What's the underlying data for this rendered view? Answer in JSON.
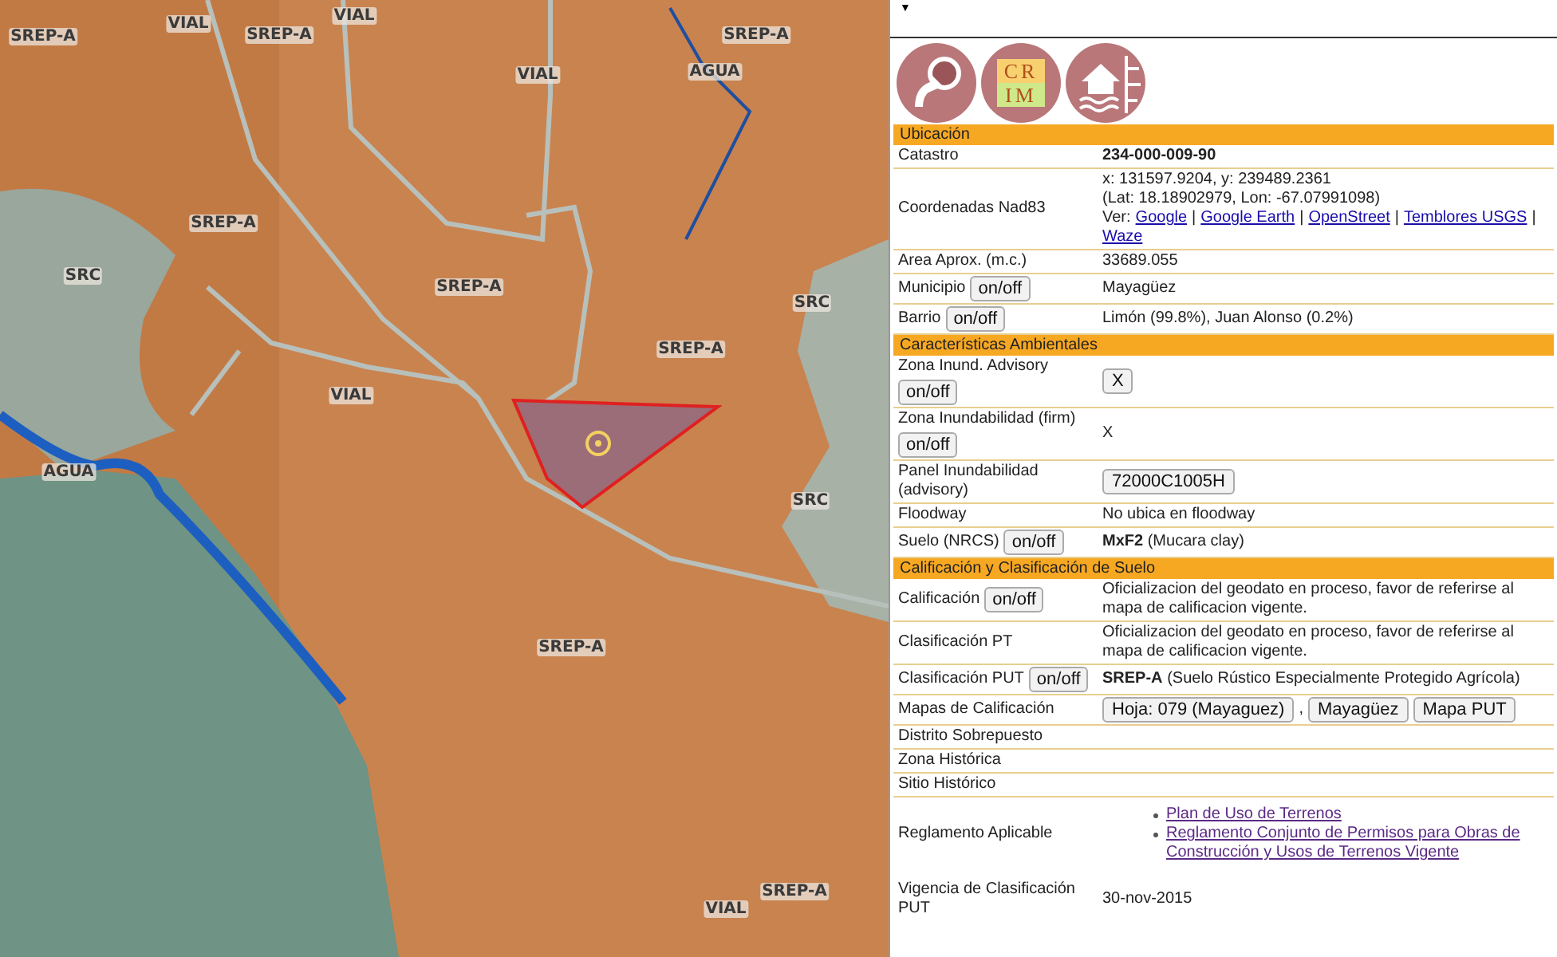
{
  "map": {
    "labels": [
      "SREP-A",
      "VIAL",
      "SREP-A",
      "VIAL",
      "VIAL",
      "AGUA",
      "SREP-A",
      "SREP-A",
      "SRC",
      "SREP-A",
      "SRC",
      "SREP-A",
      "VIAL",
      "AGUA",
      "SRC",
      "SREP-A",
      "SREP-A",
      "VIAL"
    ]
  },
  "panel": {
    "menu_caret": "▼",
    "icons": [
      {
        "kind": "share"
      },
      {
        "kind": "logo",
        "lines": [
          "CR",
          "IM"
        ]
      },
      {
        "kind": "flood"
      }
    ],
    "sections": [
      {
        "title": "Ubicación",
        "rows": [
          {
            "label": "Catastro",
            "value": [
              {
                "kind": "strong",
                "text": "234-000-009-90"
              }
            ]
          },
          {
            "label": "Coordenadas Nad83",
            "value": [
              {
                "kind": "text",
                "text": "x: 131597.9204, y: 239489.2361"
              },
              {
                "kind": "break"
              },
              {
                "kind": "text",
                "text": "(Lat: 18.18902979, Lon: -67.07991098)"
              },
              {
                "kind": "break"
              },
              {
                "kind": "text",
                "text": "Ver:"
              },
              {
                "kind": "link",
                "text": "Google"
              },
              {
                "kind": "sep",
                "text": "|"
              },
              {
                "kind": "link",
                "text": "Google Earth"
              },
              {
                "kind": "sep",
                "text": "|"
              },
              {
                "kind": "link",
                "text": "OpenStreet"
              },
              {
                "kind": "sep",
                "text": "|"
              },
              {
                "kind": "link",
                "text": "Temblores USGS"
              },
              {
                "kind": "sep",
                "text": "|"
              },
              {
                "kind": "link",
                "text": "Waze"
              }
            ]
          },
          {
            "label": "Area Aprox. (m.c.)",
            "value": [
              {
                "kind": "text",
                "text": "33689.055"
              }
            ]
          },
          {
            "label": "Municipio",
            "toggle": "on/off",
            "value": [
              {
                "kind": "text",
                "text": "Mayagüez"
              }
            ]
          },
          {
            "label": "Barrio",
            "toggle": "on/off",
            "value": [
              {
                "kind": "text",
                "text": "Limón (99.8%), Juan Alonso (0.2%)"
              }
            ]
          }
        ]
      },
      {
        "title": "Características Ambientales",
        "rows": [
          {
            "label": "Zona Inund. Advisory",
            "toggle": "on/off",
            "value": [
              {
                "kind": "button",
                "text": "X"
              }
            ]
          },
          {
            "label": "Zona Inundabilidad (firm)",
            "toggle": "on/off",
            "value": [
              {
                "kind": "text",
                "text": "X"
              }
            ]
          },
          {
            "label": "Panel Inundabilidad (advisory)",
            "value": [
              {
                "kind": "button",
                "text": "72000C1005H"
              }
            ]
          },
          {
            "label": "Floodway",
            "value": [
              {
                "kind": "text",
                "text": "No ubica en floodway"
              }
            ]
          },
          {
            "label": "Suelo (NRCS)",
            "toggle": "on/off",
            "value": [
              {
                "kind": "text",
                "text": "**MxF2** (Mucara clay)"
              }
            ]
          }
        ]
      },
      {
        "title": "Calificación y Clasificación de Suelo",
        "rows": [
          {
            "label": "Calificación",
            "toggle": "on/off",
            "value": [
              {
                "kind": "text",
                "text": "Oficializacion del geodato en proceso, favor de referirse al mapa de calificacion vigente."
              }
            ]
          },
          {
            "label": "Clasificación PT",
            "value": [
              {
                "kind": "text",
                "text": "Oficializacion del geodato en proceso, favor de referirse al mapa de calificacion vigente."
              }
            ]
          },
          {
            "label": "Clasificación PUT",
            "toggle": "on/off",
            "value": [
              {
                "kind": "text",
                "text": "**SREP-A** (Suelo Rústico Especialmente Protegido Agrícola)"
              }
            ]
          },
          {
            "label": "Mapas de Calificación",
            "value": [
              {
                "kind": "button",
                "text": "Hoja: 079 (Mayaguez)"
              },
              {
                "kind": "sep",
                "text": ","
              },
              {
                "kind": "button",
                "text": "Mayagüez"
              },
              {
                "kind": "button",
                "text": "Mapa PUT"
              }
            ]
          },
          {
            "label": "Distrito Sobrepuesto",
            "value": []
          },
          {
            "label": "Zona Histórica",
            "value": []
          },
          {
            "label": "Sitio Histórico",
            "value": []
          },
          {
            "label": "Reglamento Aplicable",
            "kind": "spaced",
            "value": [
              {
                "kind": "bullets",
                "items": [
                  "Plan de Uso de Terrenos",
                  "Reglamento Conjunto de Permisos para Obras de Construcción y Usos de Terrenos Vigente"
                ]
              }
            ]
          },
          {
            "label": "Vigencia de Clasificación PUT",
            "kind": "spaced",
            "value": [
              {
                "kind": "text",
                "text": "30-nov-2015"
              }
            ]
          }
        ]
      }
    ]
  }
}
